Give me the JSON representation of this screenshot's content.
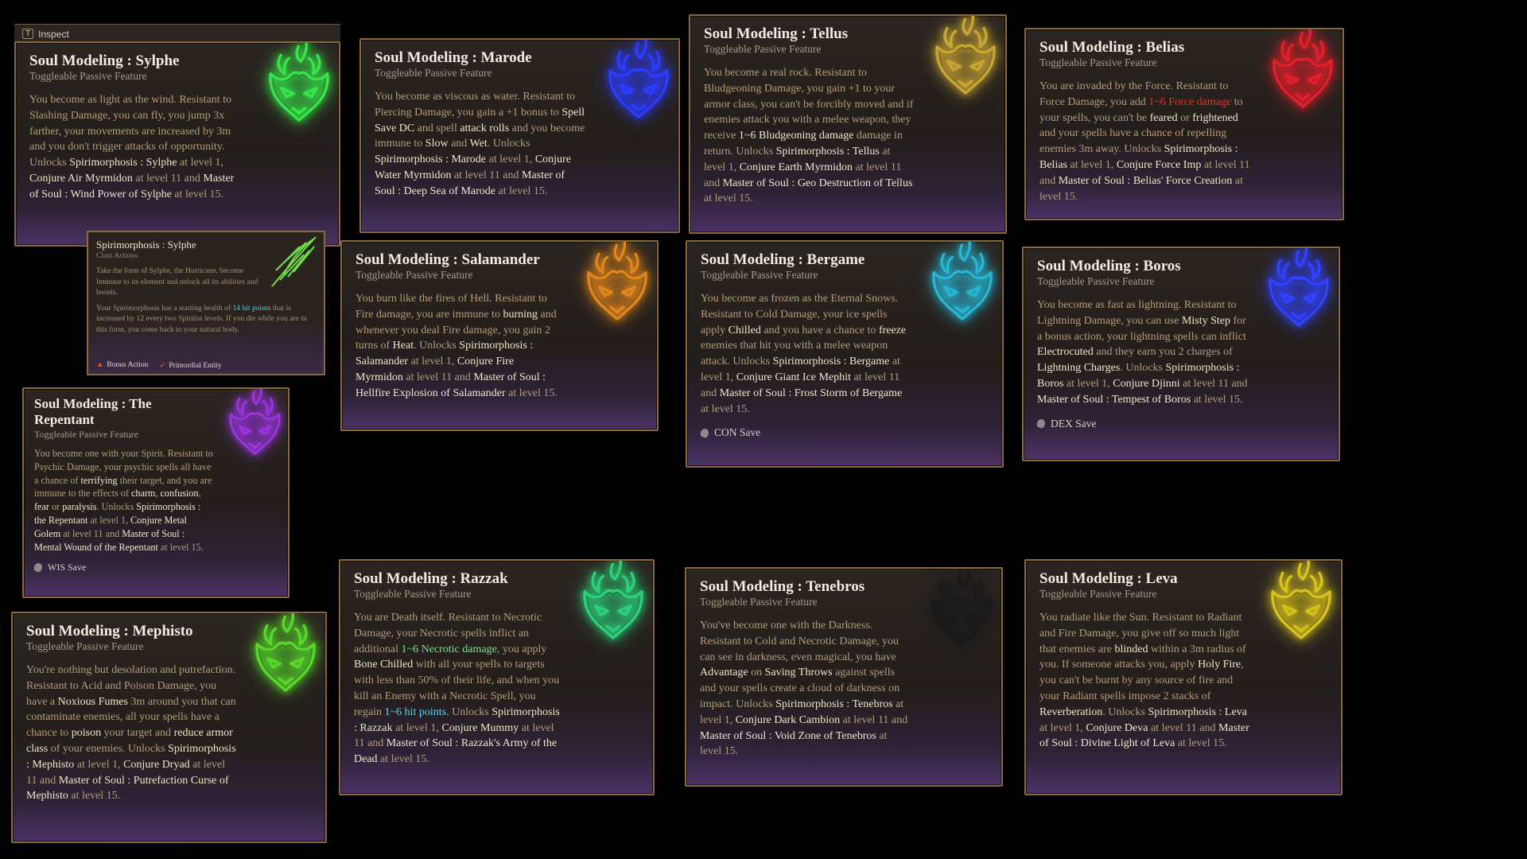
{
  "inspect": {
    "key": "T",
    "label": "Inspect"
  },
  "cards": {
    "sylphe": {
      "title": "Soul Modeling : Sylphe",
      "subtitle": "Toggleable Passive Feature",
      "t1": "You become as light as the wind. Resistant to Slashing Damage, you can fly, you jump 3x farther, your movements are increased by 3m and you don't trigger attacks of opportunity. Unlocks ",
      "b1": "Spirimorphosis : Sylphe",
      "t2": " at level 1, ",
      "b2": "Conjure Air Myrmidon",
      "t3": " at level 11 and ",
      "b3": "Master of Soul : Wind Power of Sylphe",
      "t4": " at level 15.",
      "color": "#37e64a"
    },
    "marode": {
      "title": "Soul Modeling : Marode",
      "subtitle": "Toggleable Passive Feature",
      "t1": "You become as viscous as water. Resistant to Piercing Damage, you gain a +1 bonus to ",
      "b1": "Spell Save DC",
      "t2": " and spell ",
      "b2": "attack rolls",
      "t3": " and you become immune to ",
      "b3": "Slow",
      "t4": " and ",
      "b4": "Wet",
      "t5": ". Unlocks ",
      "b5": "Spirimorphosis : Marode",
      "t6": " at level 1, ",
      "b6": "Conjure Water Myrmidon",
      "t7": " at level 11 and ",
      "b7": "Master of Soul : Deep Sea of Marode",
      "t8": " at level 15.",
      "color": "#2b3cff"
    },
    "tellus": {
      "title": "Soul Modeling : Tellus",
      "subtitle": "Toggleable Passive Feature",
      "t1": "You become a real rock. Resistant to Bludgeoning Damage, you gain +1 to your armor class, you can't be forcibly moved and if enemies attack you with a melee weapon, they receive ",
      "b1": "1~6 Bludgeoning damage",
      "t2": " damage in return. Unlocks ",
      "b2": "Spirimorphosis : Tellus",
      "t3": " at level 1, ",
      "b3": "Conjure Earth Myrmidon",
      "t4": " at level 11 and ",
      "b4": "Master of Soul : Geo Destruction of Tellus",
      "t5": " at level 15.",
      "color": "#c9a735"
    },
    "belias": {
      "title": "Soul Modeling : Belias",
      "subtitle": "Toggleable Passive Feature",
      "t1": "You are invaded by the Force. Resistant to Force Damage, you add ",
      "r1": "1~6 Force damage",
      "t2": " to your spells, you can't be ",
      "b1": "feared",
      "t3": " or ",
      "b2": "frightened",
      "t4": " and your spells have a chance of repelling enemies 3m away. Unlocks ",
      "b3": "Spirimorphosis : Belias",
      "t5": " at level 1, ",
      "b4": "Conjure Force Imp",
      "t6": " at level 11 and ",
      "b5": "Master of Soul : Belias' Force Creation",
      "t7": " at level 15.",
      "color": "#e3202a"
    },
    "salamander": {
      "title": "Soul Modeling : Salamander",
      "subtitle": "Toggleable Passive Feature",
      "t1": "You burn like the fires of Hell. Resistant to Fire damage, you are immune to ",
      "b1": "burning",
      "t2": " and whenever you deal Fire damage, you gain 2 turns of ",
      "b2": "Heat",
      "t3": ". Unlocks ",
      "b3": "Spirimorphosis : Salamander",
      "t4": " at level 1, ",
      "b4": "Conjure Fire Myrmidon",
      "t5": " at level 11 and ",
      "b5": "Master of Soul : Hellfire Explosion of Salamander",
      "t6": " at level 15.",
      "color": "#e0861c"
    },
    "bergame": {
      "title": "Soul Modeling : Bergame",
      "subtitle": "Toggleable Passive Feature",
      "t1": "You become as frozen as the Eternal Snows. Resistant to Cold Damage, your ice spells apply ",
      "b1": "Chilled",
      "t2": " and you have a chance to ",
      "b2": "freeze",
      "t3": " enemies that hit you with a melee weapon attack. Unlocks ",
      "b3": "Spirimorphosis : Bergame",
      "t4": " at level 1, ",
      "b4": "Conjure Giant Ice Mephit",
      "t5": " at level 11 and ",
      "b5": "Master of Soul : Frost Storm of Bergame",
      "t6": " at level 15.",
      "save": "CON Save",
      "color": "#27b7d4"
    },
    "boros": {
      "title": "Soul Modeling : Boros",
      "subtitle": "Toggleable Passive Feature",
      "t1": "You become as fast as lightning. Resistant to Lightning Damage, you can use ",
      "b1": "Misty Step",
      "t2": " for a bonus action, your lightning spells can inflict ",
      "b2": "Electrocuted",
      "t3": " and they earn you 2 charges of ",
      "b3": "Lightning Charges",
      "t4": ". Unlocks ",
      "b4": "Spirimorphosis : Boros",
      "t5": " at level 1, ",
      "b5": "Conjure Djinni",
      "t6": " at level 11 and ",
      "b6": "Master of Soul : Tempest of Boros",
      "t7": " at level 15.",
      "save": "DEX Save",
      "color": "#3041ff"
    },
    "repentant": {
      "title": "Soul Modeling : The Repentant",
      "subtitle": "Toggleable Passive Feature",
      "t1": "You become one with your Spirit. Resistant to Psychic Damage, your psychic spells all have a chance of ",
      "b1": "terrifying",
      "t2": " their target, and you are immune to the effects of ",
      "b2": "charm",
      "t3": ", ",
      "b3": "confusion",
      "t4": ", ",
      "b4": "fear",
      "t5": " or ",
      "b5": "paralysis",
      "t6": ". Unlocks ",
      "b6": "Spirimorphosis : the Repentant",
      "t7": " at level 1, ",
      "b7": "Conjure Metal Golem",
      "t8": " at level 11 and ",
      "b8": "Master of Soul : Mental Wound of the Repentant",
      "t9": " at level 15.",
      "save": "WIS Save",
      "color": "#9b35e0"
    },
    "mephisto": {
      "title": "Soul Modeling : Mephisto",
      "subtitle": "Toggleable Passive Feature",
      "t1": "You're nothing but desolation and putrefaction. Resistant to Acid and Poison Damage, you have a ",
      "b1": "Noxious Fumes",
      "t2": " 3m around you that can contaminate enemies, all your spells have a chance to ",
      "b2": "poison",
      "t3": " your target and ",
      "b3": "reduce armor class",
      "t4": " of your enemies. Unlocks ",
      "b4": "Spirimorphosis : Mephisto",
      "t5": " at level 1, ",
      "b5": "Conjure Dryad",
      "t6": " at level 11 and ",
      "b6": "Master of Soul : Putrefaction Curse of Mephisto",
      "t7": " at level 15.",
      "color": "#56d92a"
    },
    "razzak": {
      "title": "Soul Modeling : Razzak",
      "subtitle": "Toggleable Passive Feature",
      "t1": "You are Death itself. Resistant to Necrotic Damage, your Necrotic spells inflict an additional ",
      "g1": "1~6 Necrotic damage",
      "t2": ", you apply ",
      "b1": "Bone Chilled",
      "t3": " with all your spells to targets with less than 50% of their life, and when you kill an Enemy with a Necrotic Spell, you regain ",
      "c1": "1~6 hit points",
      "t4": ". Unlocks ",
      "b2": "Spirimorphosis : Razzak",
      "t5": " at level 1, ",
      "b3": "Conjure Mummy",
      "t6": " at level 11 and ",
      "b4": "Master of Soul : Razzak's Army of the Dead",
      "t7": " at level 15.",
      "color": "#2bd27a"
    },
    "tenebros": {
      "title": "Soul Modeling : Tenebros",
      "subtitle": "Toggleable Passive Feature",
      "t1": "You've become one with the Darkness. Resistant to Cold and Necrotic Damage, you can see in darkness, even magical, you have ",
      "b1": "Advantage",
      "t2": " on ",
      "b2": "Saving Throws",
      "t3": " against spells and your spells create a cloud of darkness on impact. Unlocks ",
      "b3": "Spirimorphosis : Tenebros",
      "t4": " at level 1, ",
      "b4": "Conjure Dark Cambion",
      "t5": " at level 11 and ",
      "b5": "Master of Soul : Void Zone of Tenebros",
      "t6": " at level 15.",
      "color": "#1a1a1a"
    },
    "leva": {
      "title": "Soul Modeling : Leva",
      "subtitle": "Toggleable Passive Feature",
      "t1": "You radiate like the Sun. Resistant to Radiant and Fire Damage, you give off so much light that enemies are ",
      "b1": "blinded",
      "t2": " within a 3m radius of you. If someone attacks you, apply ",
      "b2": "Holy Fire",
      "t3": ", you can't be burnt by any source of fire and your Radiant spells impose 2 stacks of ",
      "b3": "Reverberation",
      "t4": ". Unlocks ",
      "b4": "Spirimorphosis : Leva",
      "t5": " at level 1, ",
      "b5": "Conjure Deva",
      "t6": " at level 11 and ",
      "b6": "Master of Soul : Divine Light of Leva",
      "t7": " at level 15.",
      "color": "#d8c21e"
    }
  },
  "tooltip": {
    "title": "Spirimorphosis : Sylphe",
    "subtitle": "Class Actions",
    "p1": "Take the form of Sylphe, the Hurricane, become Immune to its element and unlock all its abilities and boosts.",
    "p2a": "Your Spirimorphosis has a starting health of ",
    "p2hp": "14 hit points",
    "p2b": " that is increased by 12 every two Spiritist levels. If you die while you are in this form, you come back to your natural body.",
    "tag1": "Bonus Action",
    "tag2": "Primordial Entity",
    "color": "#6fe04a"
  }
}
